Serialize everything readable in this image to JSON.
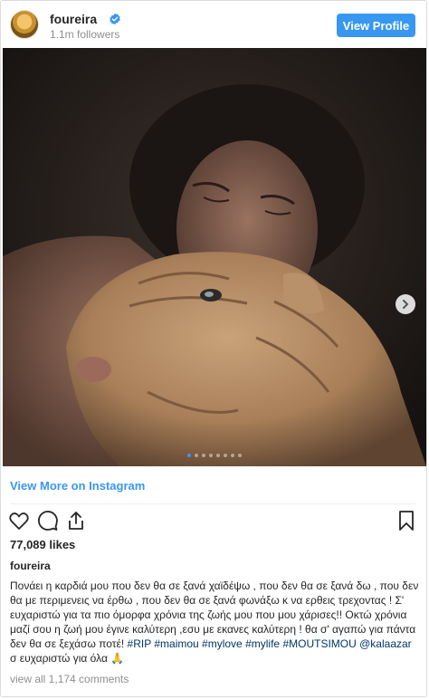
{
  "header": {
    "username": "foureira",
    "followers": "1.1m followers",
    "view_profile_label": "View Profile",
    "verified_color": "#3897f0"
  },
  "photo": {
    "carousel_total": 8,
    "carousel_active": 1,
    "next_icon": "chevron-right-icon"
  },
  "view_more_label": "View More on Instagram",
  "actions": {
    "icons": [
      "heart-icon",
      "comment-icon",
      "share-icon",
      "bookmark-icon"
    ]
  },
  "likes": "77,089 likes",
  "owner": "foureira",
  "caption": {
    "text": "Πονάει η καρδιά μου που δεν θα σε ξανά χαϊδέψω , που δεν θα σε ξανά δω , που δεν θα με περιμενεις να έρθω , που δεν θα σε ξανά φωνάξω κ να ερθεις τρεχοντας ! Σ' ευχαριστώ για τα πιο όμορφα χρόνια της ζωής μου που μου χάρισες!! Οκτώ χρόνια μαζί σου η ζωή μου έγινε καλύτερη ,εσυ με εκανες καλύτερη ! θα σ' αγαπώ για πάντα δεν θα σε ξεχάσω ποτέ!",
    "tag1": "#RIP",
    "tag2": "#maimou",
    "tag3": "#mylove",
    "tag4": "#mylife",
    "tag5": "#MOUTSIMOU",
    "mention": "@kalaazar",
    "tail": "σ ευχαριστώ για όλα 🙏"
  },
  "comments": "view all 1,174 comments",
  "colors": {
    "accent": "#3897f0",
    "hashtag": "#003569",
    "muted": "#8e8e8e"
  }
}
